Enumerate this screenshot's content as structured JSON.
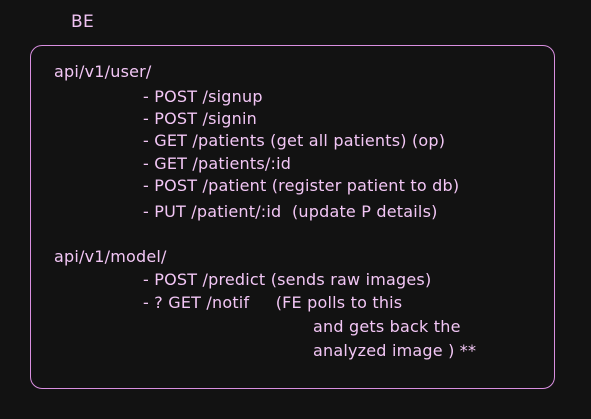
{
  "heading": "BE",
  "sections": [
    {
      "path": "api/v1/user/",
      "items": [
        "- POST /signup",
        "- POST /signin",
        "- GET /patients (get all patients) (op)",
        "- GET /patients/:id",
        "- POST /patient (register patient to db)",
        "- PUT /patient/:id  (update P details)"
      ]
    },
    {
      "path": "api/v1/model/",
      "items": [
        "- POST /predict (sends raw images)",
        "- ? GET /notif     (FE polls to this"
      ],
      "note_lines": [
        "and gets back the",
        "analyzed image ) **"
      ]
    }
  ]
}
